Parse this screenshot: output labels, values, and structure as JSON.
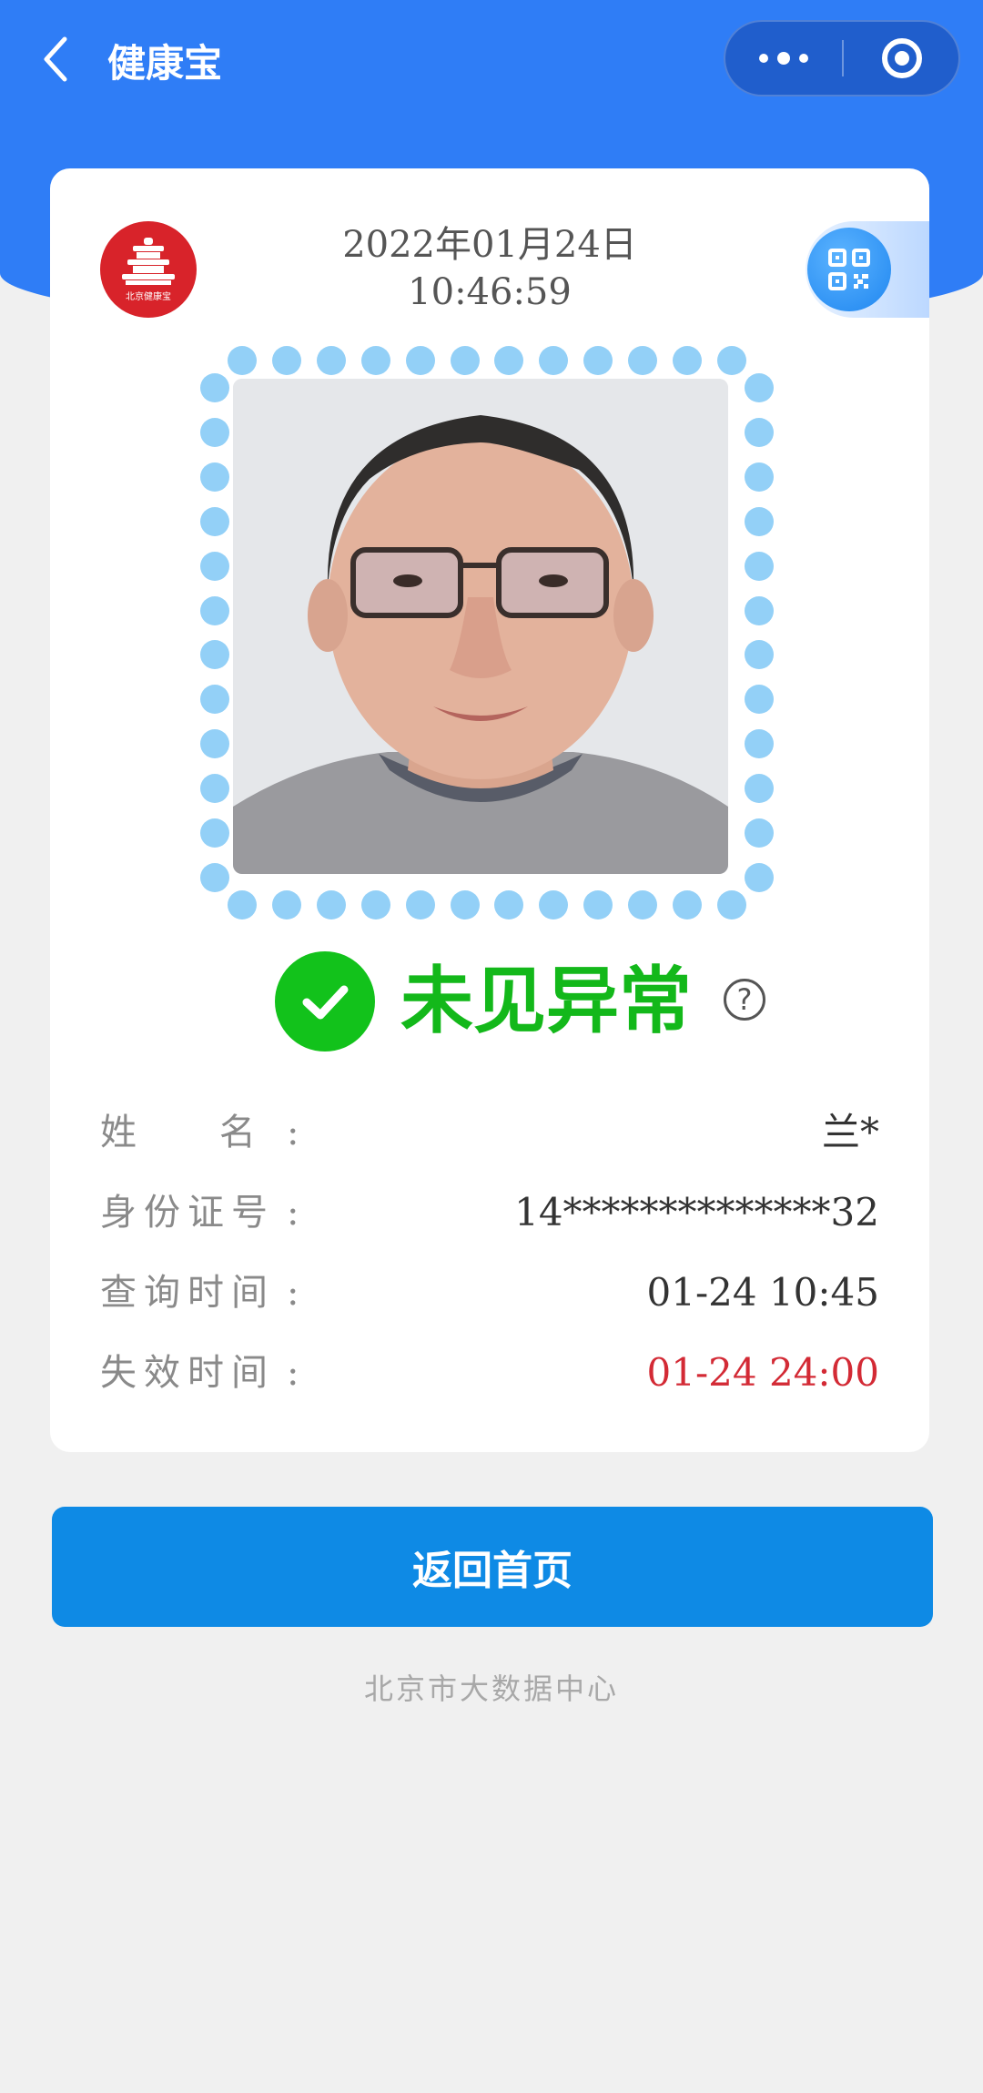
{
  "app": {
    "title": "健康宝"
  },
  "card": {
    "date": "2022年01月24日",
    "time": "10:46:59",
    "logo_caption": "北京健康宝",
    "status_text": "未见异常",
    "help_symbol": "?",
    "status_color": "#13b81a",
    "fields": [
      {
        "label": "姓    名",
        "value": "兰*"
      },
      {
        "label": "身份证号",
        "value": "14**************32"
      },
      {
        "label": "查询时间",
        "value": "01-24 10:45"
      },
      {
        "label": "失效时间",
        "value": "01-24 24:00",
        "color": "#d32a35"
      }
    ],
    "colon": ":"
  },
  "actions": {
    "home_label": "返回首页"
  },
  "footer": {
    "text": "北京市大数据中心"
  },
  "icons": [
    "back-chevron-icon",
    "more-dots-icon",
    "target-circle-icon",
    "beijing-health-logo",
    "qr-code-icon",
    "check-icon",
    "help-icon"
  ],
  "colors": {
    "brand_blue": "#2f7df6",
    "button_blue": "#0e8ae5",
    "dot_border": "#93d0f7"
  }
}
